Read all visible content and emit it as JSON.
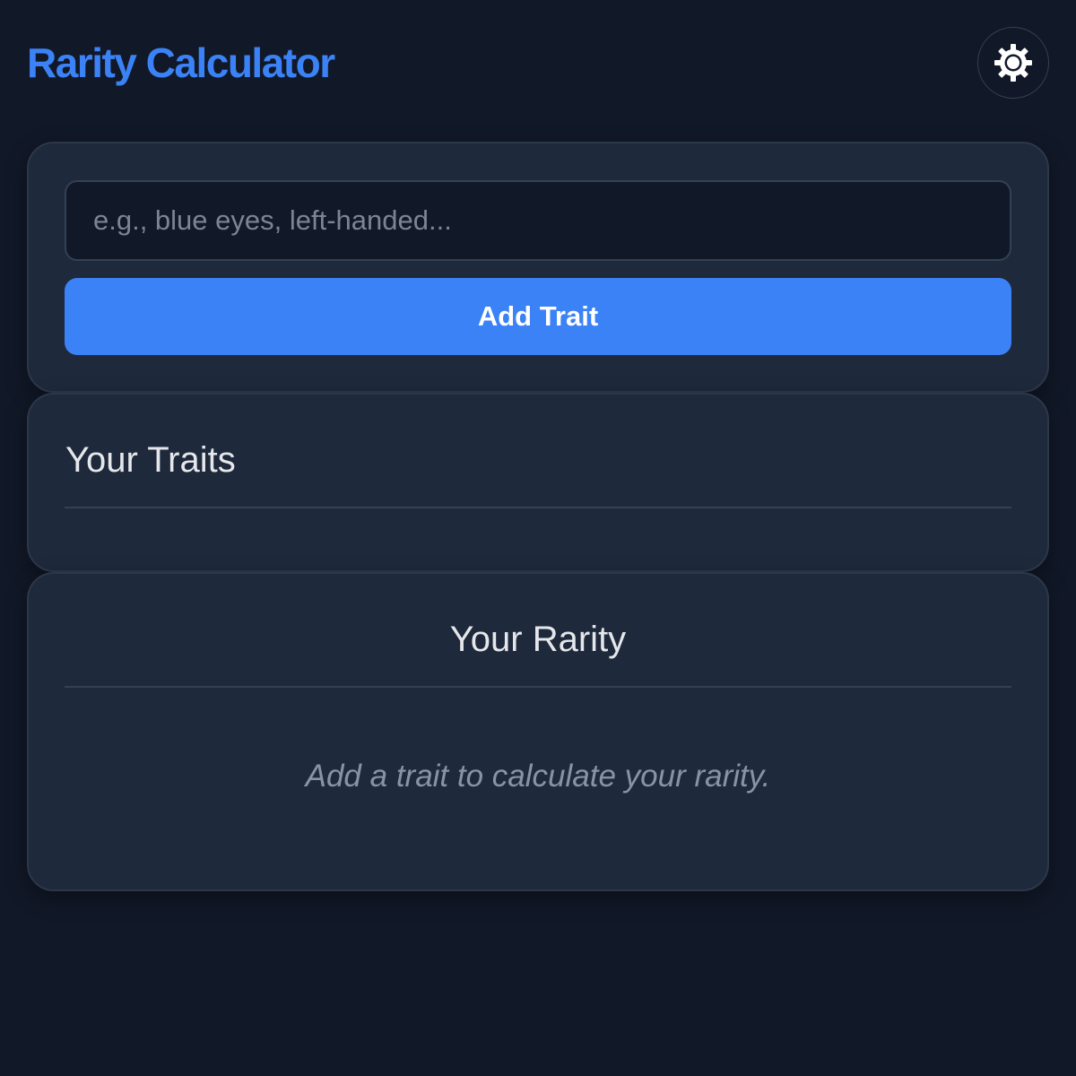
{
  "header": {
    "title": "Rarity Calculator",
    "theme_toggle_icon": "sun-icon"
  },
  "input_card": {
    "placeholder": "e.g., blue eyes, left-handed...",
    "value": "",
    "add_button_label": "Add Trait"
  },
  "traits_card": {
    "title": "Your Traits",
    "items": []
  },
  "rarity_card": {
    "title": "Your Rarity",
    "empty_message": "Add a trait to calculate your rarity."
  },
  "colors": {
    "accent": "#3b82f6",
    "background": "#111827",
    "card": "#1e293b"
  }
}
